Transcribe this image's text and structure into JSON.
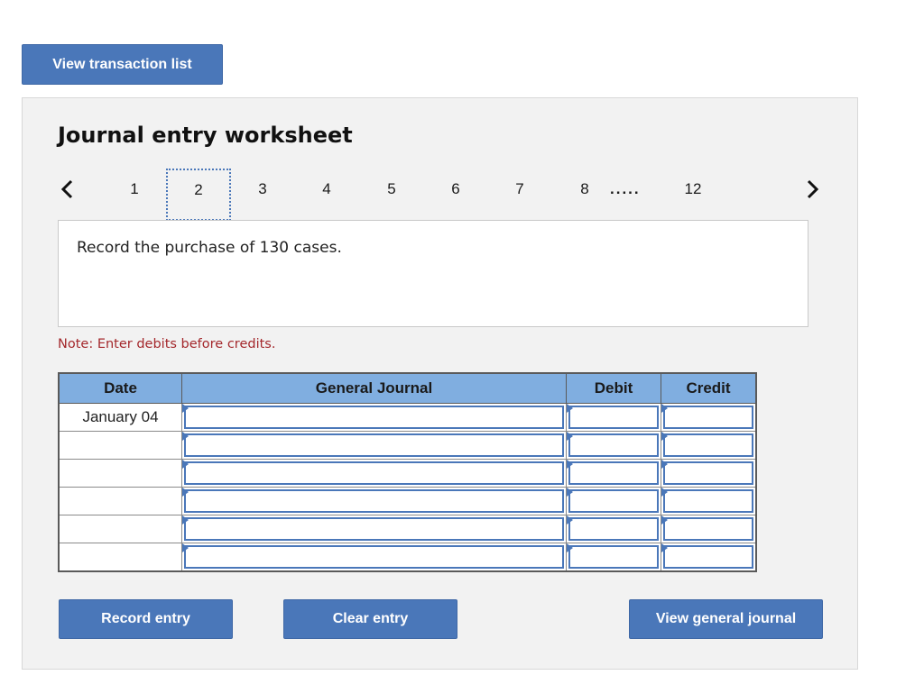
{
  "header": {
    "view_transaction_list_label": "View transaction list"
  },
  "worksheet": {
    "title": "Journal entry worksheet",
    "pager": {
      "pages": [
        "1",
        "2",
        "3",
        "4",
        "5",
        "6",
        "7",
        "8"
      ],
      "ellipsis": ".....",
      "last_page": "12",
      "active_page": "2",
      "prev_icon": "chevron-left-icon",
      "next_icon": "chevron-right-icon"
    },
    "question": "Record the purchase of 130 cases.",
    "note": "Note: Enter debits before credits.",
    "table": {
      "columns": [
        "Date",
        "General Journal",
        "Debit",
        "Credit"
      ],
      "rows": [
        {
          "date": "January 04",
          "account": "",
          "debit": "",
          "credit": ""
        },
        {
          "date": "",
          "account": "",
          "debit": "",
          "credit": ""
        },
        {
          "date": "",
          "account": "",
          "debit": "",
          "credit": ""
        },
        {
          "date": "",
          "account": "",
          "debit": "",
          "credit": ""
        },
        {
          "date": "",
          "account": "",
          "debit": "",
          "credit": ""
        },
        {
          "date": "",
          "account": "",
          "debit": "",
          "credit": ""
        }
      ]
    },
    "buttons": {
      "record_entry": "Record entry",
      "clear_entry": "Clear entry",
      "view_general_journal": "View general journal"
    }
  },
  "colors": {
    "button": "#4a77b9",
    "table_header": "#80aee0",
    "note_text": "#a4282c",
    "panel_bg": "#f2f2f2"
  }
}
